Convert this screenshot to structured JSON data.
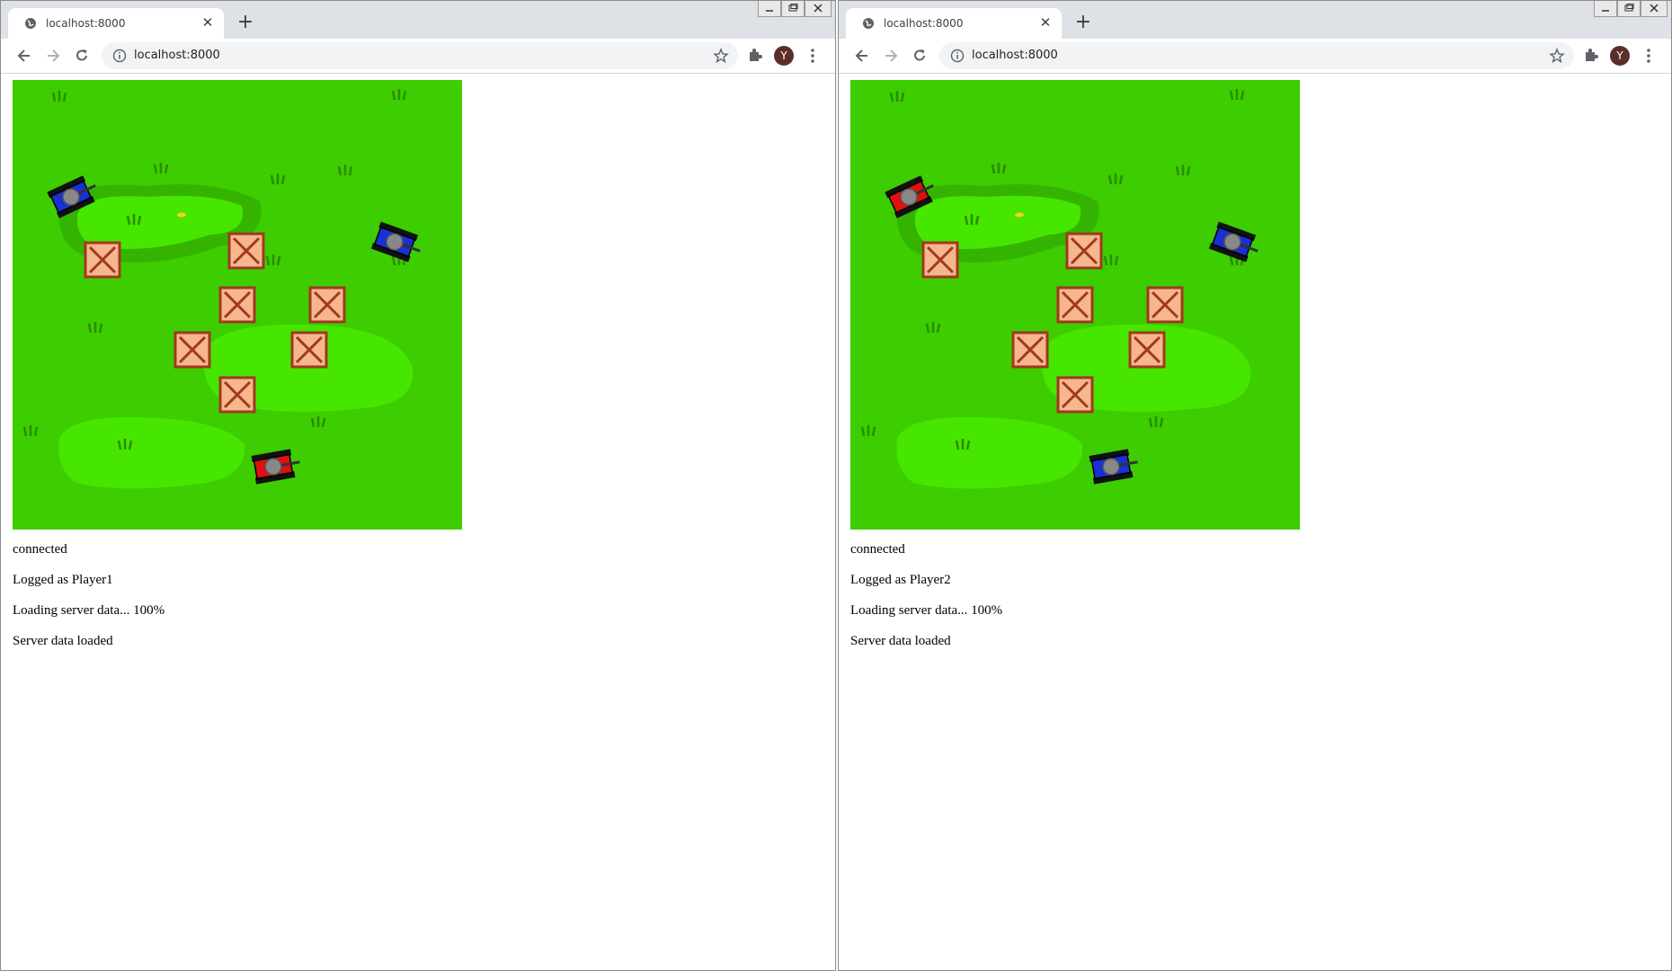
{
  "windows": [
    {
      "tab_title": "localhost:8000",
      "url": "localhost:8000",
      "avatar_letter": "Y",
      "messages": [
        "connected",
        "Logged as Player1",
        "Loading server data... 100%",
        "Server data loaded"
      ],
      "tank_colors": {
        "top_left": "#1a2fd6",
        "right": "#1a2fd6",
        "bottom": "#e01010"
      }
    },
    {
      "tab_title": "localhost:8000",
      "url": "localhost:8000",
      "avatar_letter": "Y",
      "messages": [
        "connected",
        "Logged as Player2",
        "Loading server data... 100%",
        "Server data loaded"
      ],
      "tank_colors": {
        "top_left": "#e01010",
        "right": "#1a2fd6",
        "bottom": "#1a2fd6"
      }
    }
  ],
  "icons": {
    "back": "arrow-left",
    "forward": "arrow-right",
    "reload": "reload",
    "info": "info-circle",
    "star": "star-outline",
    "extensions": "puzzle-piece",
    "menu": "three-dots-vertical"
  },
  "colors": {
    "grass": "#3dcd00",
    "grass_light": "#46e600",
    "crate_fill": "#f6b68e",
    "crate_border": "#a0391e"
  }
}
